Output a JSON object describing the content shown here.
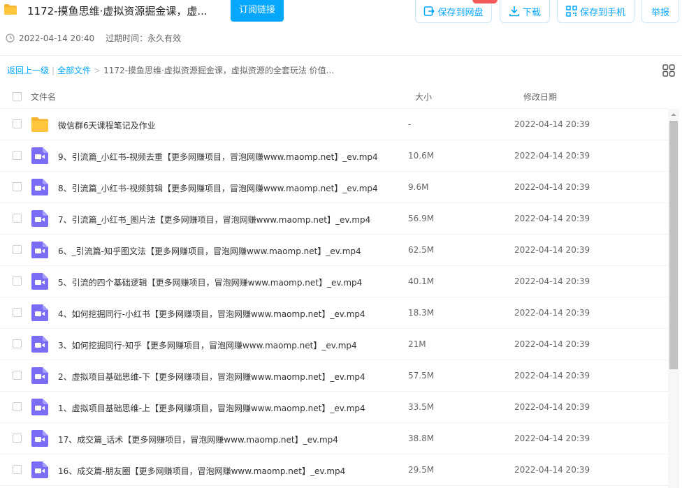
{
  "header": {
    "title": "1172-摸鱼思维·虚拟资源掘金课，虚...",
    "subscribe_label": "订阅链接",
    "save_cloud_label": "保存到网盘",
    "download_label": "下载",
    "save_phone_label": "保存到手机",
    "report_label": "举报",
    "share_date": "2022-04-14 20:40",
    "expiry": "过期时间：永久有效"
  },
  "breadcrumb": {
    "back": "返回上一级",
    "sep": "|",
    "all_files": "全部文件",
    "arrow": ">",
    "current": "1172-摸鱼思维·虚拟资源掘金课，虚拟资源的全套玩法 价值..."
  },
  "table": {
    "col_name": "文件名",
    "col_size": "大小",
    "col_date": "修改日期",
    "rows": [
      {
        "type": "folder",
        "name": "微信群6天课程笔记及作业",
        "size": "-",
        "date": "2022-04-14 20:39"
      },
      {
        "type": "video",
        "name": "9、引流篇_小红书-视频去重【更多网赚项目，冒泡网赚www.maomp.net】_ev.mp4",
        "size": "10.6M",
        "date": "2022-04-14 20:39"
      },
      {
        "type": "video",
        "name": "8、引流篇_小红书-视频剪辑【更多网赚项目，冒泡网赚www.maomp.net】_ev.mp4",
        "size": "9.6M",
        "date": "2022-04-14 20:39"
      },
      {
        "type": "video",
        "name": "7、引流篇_小红书_图片法【更多网赚项目，冒泡网赚www.maomp.net】_ev.mp4",
        "size": "56.9M",
        "date": "2022-04-14 20:39"
      },
      {
        "type": "video",
        "name": "6、_引流篇-知乎图文法【更多网赚项目，冒泡网赚www.maomp.net】_ev.mp4",
        "size": "62.5M",
        "date": "2022-04-14 20:39"
      },
      {
        "type": "video",
        "name": "5、引流的四个基础逻辑【更多网赚项目，冒泡网赚www.maomp.net】_ev.mp4",
        "size": "40.1M",
        "date": "2022-04-14 20:39"
      },
      {
        "type": "video",
        "name": "4、如何挖掘同行-小红书【更多网赚项目，冒泡网赚www.maomp.net】_ev.mp4",
        "size": "18.3M",
        "date": "2022-04-14 20:39"
      },
      {
        "type": "video",
        "name": "3、如何挖掘同行-知乎【更多网赚项目，冒泡网赚www.maomp.net】_ev.mp4",
        "size": "21M",
        "date": "2022-04-14 20:39"
      },
      {
        "type": "video",
        "name": "2、虚拟项目基础思维-下【更多网赚项目，冒泡网赚www.maomp.net】_ev.mp4",
        "size": "57.5M",
        "date": "2022-04-14 20:39"
      },
      {
        "type": "video",
        "name": "1、虚拟项目基础思维-上【更多网赚项目，冒泡网赚www.maomp.net】_ev.mp4",
        "size": "33.5M",
        "date": "2022-04-14 20:39"
      },
      {
        "type": "video",
        "name": "17、成交篇_话术【更多网赚项目，冒泡网赚www.maomp.net】_ev.mp4",
        "size": "38.8M",
        "date": "2022-04-14 20:39"
      },
      {
        "type": "video",
        "name": "16、成交篇-朋友圈【更多网赚项目，冒泡网赚www.maomp.net】_ev.mp4",
        "size": "29.5M",
        "date": "2022-04-14 20:39"
      }
    ]
  },
  "colors": {
    "accent": "#06a7ff",
    "folder": "#ffc53d",
    "video": "#7b6cf6"
  }
}
